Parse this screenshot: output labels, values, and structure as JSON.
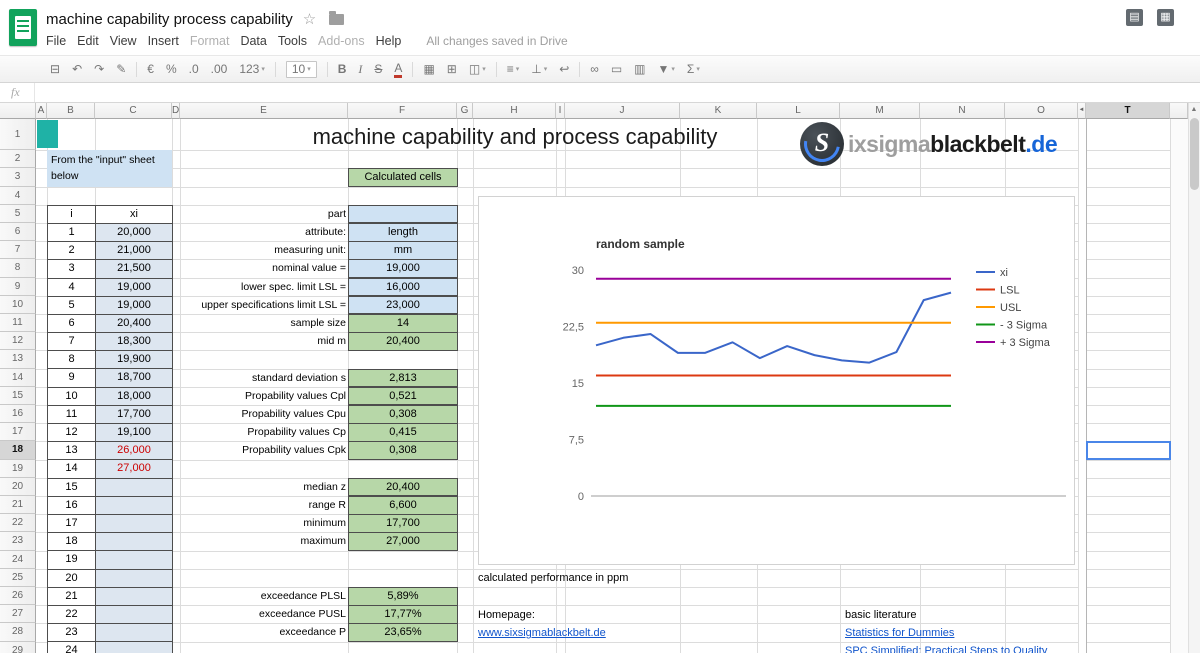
{
  "topbar": {
    "doc_title": "machine capability process capability",
    "star_icon": "☆",
    "menus": [
      {
        "label": "File",
        "enabled": true
      },
      {
        "label": "Edit",
        "enabled": true
      },
      {
        "label": "View",
        "enabled": true
      },
      {
        "label": "Insert",
        "enabled": true
      },
      {
        "label": "Format",
        "enabled": false
      },
      {
        "label": "Data",
        "enabled": true
      },
      {
        "label": "Tools",
        "enabled": true
      },
      {
        "label": "Add-ons",
        "enabled": false
      },
      {
        "label": "Help",
        "enabled": true
      }
    ],
    "status": "All changes saved in Drive",
    "right_icons": [
      {
        "name": "view-list-icon",
        "glyph": "▤"
      },
      {
        "name": "apps-grid-icon",
        "glyph": "▦"
      }
    ]
  },
  "toolbar": {
    "items": [
      {
        "name": "print-icon",
        "glyph": "⊟"
      },
      {
        "name": "undo-icon",
        "glyph": "↶"
      },
      {
        "name": "redo-icon",
        "glyph": "↷"
      },
      {
        "name": "paint-format-icon",
        "glyph": "✎"
      },
      {
        "type": "sep"
      },
      {
        "name": "currency-format-icon",
        "glyph": "€"
      },
      {
        "name": "percent-format-icon",
        "glyph": "%"
      },
      {
        "name": "decrease-decimals-icon",
        "glyph": ".0"
      },
      {
        "name": "increase-decimals-icon",
        "glyph": ".00"
      },
      {
        "name": "number-format-icon",
        "glyph": "123",
        "caret": true
      },
      {
        "type": "sep"
      },
      {
        "name": "font-size-select",
        "glyph": "10",
        "caret": true,
        "boxed": true
      },
      {
        "type": "sep"
      },
      {
        "name": "bold-icon",
        "glyph": "B",
        "bold": true
      },
      {
        "name": "italic-icon",
        "glyph": "I",
        "italic": true
      },
      {
        "name": "strikethrough-icon",
        "glyph": "S",
        "strike": true
      },
      {
        "name": "text-color-icon",
        "glyph": "A",
        "underbar": true
      },
      {
        "type": "sep"
      },
      {
        "name": "fill-color-icon",
        "glyph": "▦"
      },
      {
        "name": "borders-icon",
        "glyph": "⊞"
      },
      {
        "name": "merge-cells-icon",
        "glyph": "◫",
        "caret": true
      },
      {
        "type": "sep"
      },
      {
        "name": "horizontal-align-icon",
        "glyph": "≡",
        "caret": true
      },
      {
        "name": "vertical-align-icon",
        "glyph": "⊥",
        "caret": true
      },
      {
        "name": "text-wrap-icon",
        "glyph": "↩"
      },
      {
        "type": "sep"
      },
      {
        "name": "insert-link-icon",
        "glyph": "∞"
      },
      {
        "name": "insert-comment-icon",
        "glyph": "▭"
      },
      {
        "name": "insert-chart-icon",
        "glyph": "▥"
      },
      {
        "name": "filter-icon",
        "glyph": "▼",
        "caret": true
      },
      {
        "name": "functions-icon",
        "glyph": "Σ",
        "caret": true
      }
    ]
  },
  "formula_bar": {
    "fx": "fx",
    "value": ""
  },
  "grid": {
    "col_headers": [
      "A",
      "B",
      "C",
      "D",
      "E",
      "F",
      "G",
      "H",
      "I",
      "J",
      "K",
      "L",
      "M",
      "N",
      "O"
    ],
    "scrolled_col_header": "T",
    "pane_arrow": "◄",
    "scroll_up_arrow": "▲",
    "row_headers": [
      "1",
      "2",
      "3",
      "4",
      "5",
      "6",
      "7",
      "8",
      "9",
      "10",
      "11",
      "12",
      "13",
      "14",
      "15",
      "16",
      "17",
      "18",
      "19",
      "20",
      "21",
      "22",
      "23",
      "24",
      "25",
      "26",
      "27",
      "28",
      "29"
    ],
    "selection": {
      "row": "18",
      "col": "T"
    }
  },
  "content": {
    "sheet_title": "machine capability and process capability",
    "note_line1": "From the \"input\" sheet",
    "note_line2": "below",
    "calculated_cells": "Calculated cells",
    "data_table": {
      "col1": "i",
      "col2": "xi",
      "rows": [
        {
          "i": "1",
          "xi": "20,000",
          "red": false
        },
        {
          "i": "2",
          "xi": "21,000",
          "red": false
        },
        {
          "i": "3",
          "xi": "21,500",
          "red": false
        },
        {
          "i": "4",
          "xi": "19,000",
          "red": false
        },
        {
          "i": "5",
          "xi": "19,000",
          "red": false
        },
        {
          "i": "6",
          "xi": "20,400",
          "red": false
        },
        {
          "i": "7",
          "xi": "18,300",
          "red": false
        },
        {
          "i": "8",
          "xi": "19,900",
          "red": false
        },
        {
          "i": "9",
          "xi": "18,700",
          "red": false
        },
        {
          "i": "10",
          "xi": "18,000",
          "red": false
        },
        {
          "i": "11",
          "xi": "17,700",
          "red": false
        },
        {
          "i": "12",
          "xi": "19,100",
          "red": false
        },
        {
          "i": "13",
          "xi": "26,000",
          "red": true
        },
        {
          "i": "14",
          "xi": "27,000",
          "red": true
        },
        {
          "i": "15",
          "xi": "",
          "red": false
        },
        {
          "i": "16",
          "xi": "",
          "red": false
        },
        {
          "i": "17",
          "xi": "",
          "red": false
        },
        {
          "i": "18",
          "xi": "",
          "red": false
        },
        {
          "i": "19",
          "xi": "",
          "red": false
        },
        {
          "i": "20",
          "xi": "",
          "red": false
        },
        {
          "i": "21",
          "xi": "",
          "red": false
        },
        {
          "i": "22",
          "xi": "",
          "red": false
        },
        {
          "i": "23",
          "xi": "",
          "red": false
        },
        {
          "i": "24",
          "xi": "",
          "red": false
        }
      ]
    },
    "params": [
      {
        "row": 5,
        "label": "part",
        "value": "",
        "style": "blue"
      },
      {
        "row": 6,
        "label": "attribute:",
        "value": "length",
        "style": "blue"
      },
      {
        "row": 7,
        "label": "measuring unit:",
        "value": "mm",
        "style": "blue"
      },
      {
        "row": 8,
        "label": "nominal value =",
        "value": "19,000",
        "style": "blue"
      },
      {
        "row": 9,
        "label": "lower spec. limit LSL =",
        "value": "16,000",
        "style": "blue"
      },
      {
        "row": 10,
        "label": "upper specifications limit LSL =",
        "value": "23,000",
        "style": "blue"
      },
      {
        "row": 11,
        "label": "sample size",
        "value": "14",
        "style": "green"
      },
      {
        "row": 12,
        "label": "mid m",
        "value": "20,400",
        "style": "green"
      },
      {
        "row": 14,
        "label": "standard deviation s",
        "value": "2,813",
        "style": "green"
      },
      {
        "row": 15,
        "label": "Propability values Cpl",
        "value": "0,521",
        "style": "green"
      },
      {
        "row": 16,
        "label": "Propability values Cpu",
        "value": "0,308",
        "style": "green"
      },
      {
        "row": 17,
        "label": "Propability values Cp",
        "value": "0,415",
        "style": "green"
      },
      {
        "row": 18,
        "label": "Propability values Cpk",
        "value": "0,308",
        "style": "green"
      },
      {
        "row": 20,
        "label": "median z",
        "value": "20,400",
        "style": "green"
      },
      {
        "row": 21,
        "label": "range R",
        "value": "6,600",
        "style": "green"
      },
      {
        "row": 22,
        "label": "minimum",
        "value": "17,700",
        "style": "green"
      },
      {
        "row": 23,
        "label": "maximum",
        "value": "27,000",
        "style": "green"
      },
      {
        "row": 26,
        "label": "exceedance PLSL",
        "value": "5,89%",
        "style": "green"
      },
      {
        "row": 27,
        "label": "exceedance PUSL",
        "value": "17,77%",
        "style": "green"
      },
      {
        "row": 28,
        "label": "exceedance P",
        "value": "23,65%",
        "style": "green"
      }
    ],
    "ppm_label": "calculated performance in ppm",
    "footer": {
      "homepage_label": "Homepage:",
      "homepage_link": "www.sixsigmablackbelt.de",
      "literature_label": "basic literature",
      "literature_links": [
        "Statistics for Dummies",
        "SPC Simplified: Practical Steps to Quality"
      ]
    }
  },
  "logo": {
    "initial": "S",
    "part1": "ixsigma",
    "part2": "blackbelt",
    "part3": ".de"
  },
  "colors": {
    "teal_cell": "#1fb2a6",
    "note_blue": "#cfe2f3",
    "calc_green": "#b7d7a8",
    "value_blue": "#cfe2f3",
    "value_green": "#b7d7a8",
    "xi_column": "#dde6f0",
    "red_value": "#cc0000",
    "link_blue": "#1155cc",
    "selection_blue": "#4a86e8"
  },
  "chart_data": {
    "type": "line",
    "title": "random sample",
    "x": [
      1,
      2,
      3,
      4,
      5,
      6,
      7,
      8,
      9,
      10,
      11,
      12,
      13,
      14
    ],
    "series": [
      {
        "name": "xi",
        "color": "#3a66c9",
        "values": [
          20,
          21,
          21.5,
          19,
          19,
          20.4,
          18.3,
          19.9,
          18.7,
          18,
          17.7,
          19.1,
          26,
          27
        ]
      },
      {
        "name": "LSL",
        "color": "#dc3912",
        "constant": 16
      },
      {
        "name": "USL",
        "color": "#ff9900",
        "constant": 23
      },
      {
        "name": "- 3 Sigma",
        "color": "#109618",
        "constant": 11.96
      },
      {
        "name": "+ 3 Sigma",
        "color": "#990099",
        "constant": 28.84
      }
    ],
    "ylim": [
      0,
      30
    ],
    "yticks": [
      0,
      7.5,
      15,
      22.5,
      30
    ],
    "ytick_labels": [
      "0",
      "7,5",
      "15",
      "22,5",
      "30"
    ],
    "grid": false,
    "legend_position": "right"
  }
}
